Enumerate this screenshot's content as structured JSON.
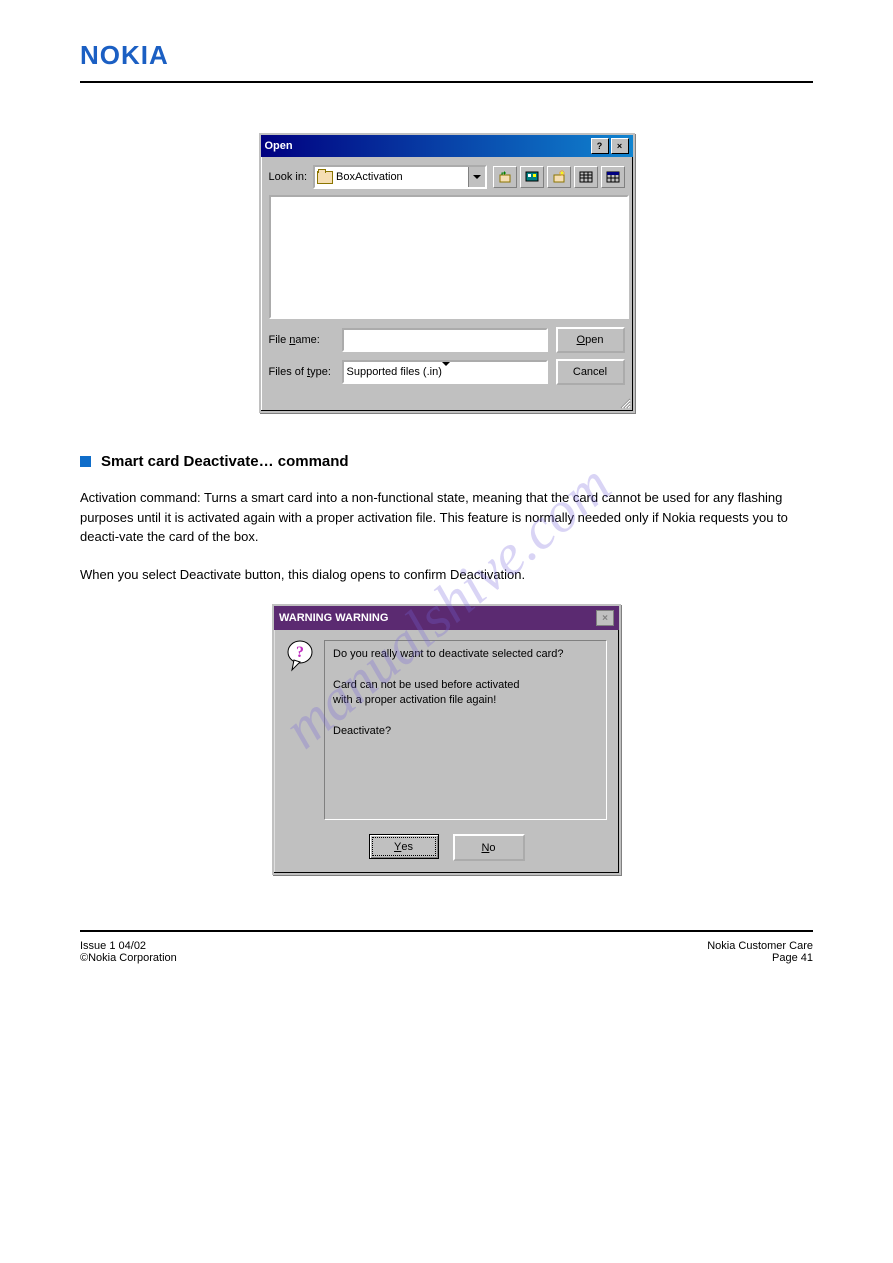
{
  "watermark": "manualshive.com",
  "header": {
    "logo_text": "NOKIA"
  },
  "open_dialog": {
    "title": "Open",
    "help_btn": "?",
    "close_btn": "×",
    "lookin_label": "Look in:",
    "lookin_value": "BoxActivation",
    "filename_label": "File name:",
    "filename_value": "",
    "filetypes_label": "Files of type:",
    "filetypes_value": "Supported files (.in)",
    "open_btn": "Open",
    "cancel_btn": "Cancel"
  },
  "section": {
    "title": "Smart card Deactivate… command",
    "para1": "Activation command: Turns a smart card into a non-functional state, meaning that the card cannot be used for any flashing purposes until it is activated again with a proper activation file. This feature is normally needed only if Nokia requests you to deacti-vate the card of the box.",
    "para2": "When you select Deactivate button, this dialog opens to confirm Deactivation."
  },
  "warning_dialog": {
    "title": "WARNING WARNING",
    "close_btn": "×",
    "line1": "Do you really want to deactivate selected card?",
    "line2": "Card can not be used before activated",
    "line3": "with a proper activation file again!",
    "line4": "Deactivate?",
    "yes_btn": "Yes",
    "no_btn": "No"
  },
  "footer": {
    "left1": "Issue 1 04/02",
    "left2": "©Nokia Corporation",
    "right1": "Nokia Customer Care",
    "right2": "Page 41"
  }
}
